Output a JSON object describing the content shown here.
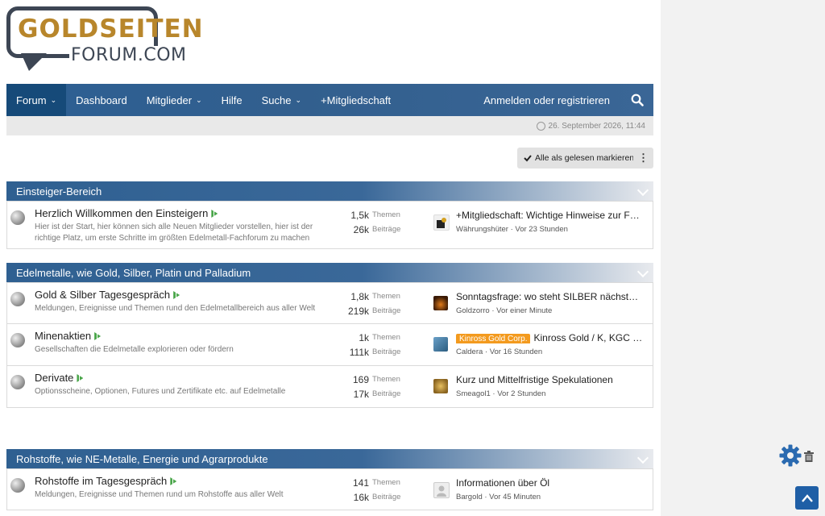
{
  "logo": {
    "gold_text": "GOLDSEITEN",
    "sub_text": "FORUM.COM"
  },
  "nav": {
    "items": [
      {
        "label": "Forum",
        "dropdown": true,
        "active": true
      },
      {
        "label": "Dashboard",
        "dropdown": false
      },
      {
        "label": "Mitglieder",
        "dropdown": true
      },
      {
        "label": "Hilfe",
        "dropdown": false
      },
      {
        "label": "Suche",
        "dropdown": true
      },
      {
        "label": "+Mitgliedschaft",
        "dropdown": false
      }
    ],
    "login_label": "Anmelden oder registrieren",
    "caret": "⌄"
  },
  "timestamp": "26. September 2026, 11:44",
  "mark_read_label": "Alle als gelesen markieren",
  "more_label": "⋮",
  "labels": {
    "themen": "Themen",
    "beitraege": "Beiträge"
  },
  "sections": [
    {
      "title": "Einsteiger-Bereich",
      "forums": [
        {
          "title": "Herzlich Willkommen den Einsteigern",
          "desc": "Hier ist der Start, hier können sich alle Neuen Mitglieder vorstellen, hier ist der richtige Platz, um erste Schritte im größten Edelmetall-Fachforum zu machen",
          "themen": "1,5k",
          "beitraege": "26k",
          "last_title": "+Mitgliedschaft: Wichtige Hinweise zur F…",
          "last_meta": "Währungshüter · Vor 23 Stunden",
          "prefix": ""
        }
      ]
    },
    {
      "title": "Edelmetalle, wie Gold, Silber, Platin und Palladium",
      "forums": [
        {
          "title": "Gold & Silber Tagesgespräch",
          "desc": "Meldungen, Ereignisse und Themen rund den Edelmetallbereich aus aller Welt",
          "themen": "1,8k",
          "beitraege": "219k",
          "last_title": "Sonntagsfrage: wo steht SILBER nächst…",
          "last_meta": "Goldzorro · Vor einer Minute",
          "prefix": ""
        },
        {
          "title": "Minenaktien",
          "desc": "Gesellschaften die Edelmetalle explorieren oder fördern",
          "themen": "1k",
          "beitraege": "111k",
          "last_title": "Kinross Gold / K, KGC …",
          "last_meta": "Caldera · Vor 16 Stunden",
          "prefix": "Kinross Gold Corp."
        },
        {
          "title": "Derivate",
          "desc": "Optionsscheine, Optionen, Futures und Zertifikate etc. auf Edelmetalle",
          "themen": "169",
          "beitraege": "17k",
          "last_title": "Kurz und Mittelfristige Spekulationen",
          "last_meta": "Smeagol1 · Vor 2 Stunden",
          "prefix": ""
        }
      ]
    },
    {
      "title": "Rohstoffe, wie NE-Metalle, Energie und Agrarprodukte",
      "forums": [
        {
          "title": "Rohstoffe im Tagesgespräch",
          "desc": "Meldungen, Ereignisse und Themen rund um Rohstoffe aus aller Welt",
          "themen": "141",
          "beitraege": "16k",
          "last_title": "Informationen über Öl",
          "last_meta": "Bargold · Vor 45 Minuten",
          "prefix": ""
        }
      ]
    }
  ],
  "colors": {
    "nav": "#2d5f93",
    "nav_active": "#164a79",
    "prefix": "#f39a1e",
    "totop": "#1f5fa6"
  },
  "icons": [
    "search-icon",
    "clock-icon",
    "check-icon",
    "more-icon",
    "chevron-down-icon",
    "forum-icon",
    "new-posts-icon",
    "gear-icon",
    "trash-icon",
    "arrow-up-icon"
  ]
}
